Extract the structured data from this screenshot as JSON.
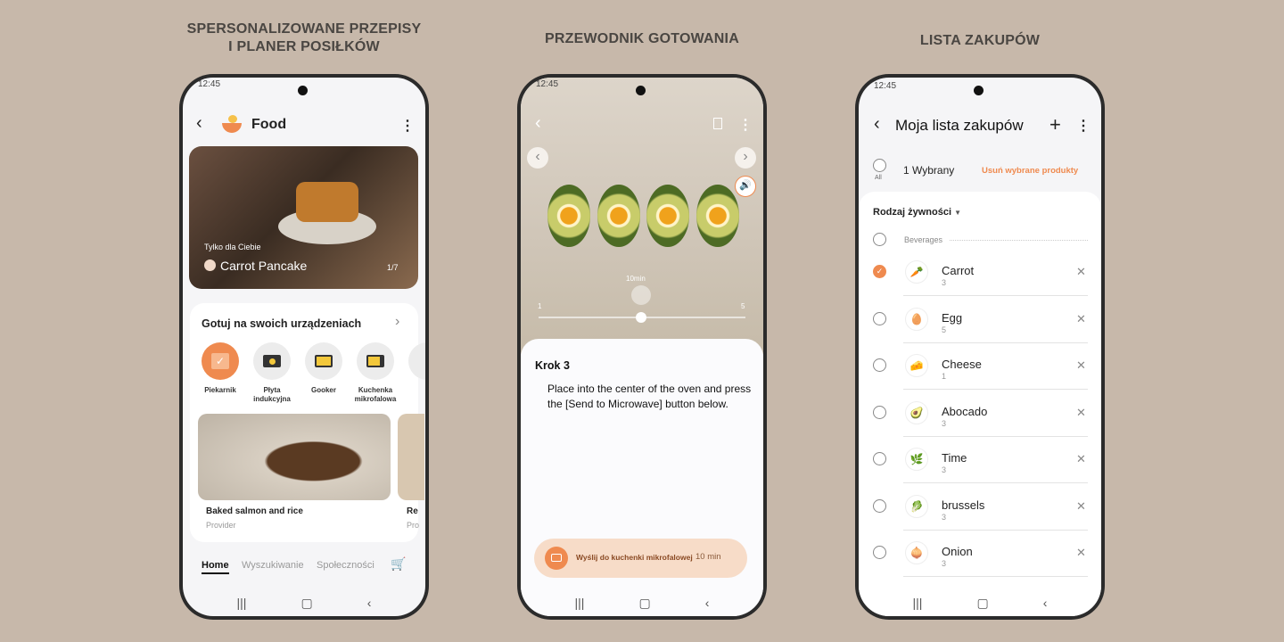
{
  "captions": [
    "SPERSONALIZOWANE PRZEPISY",
    "I PLANER POSIŁKÓW",
    "PRZEWODNIK GOTOWANIA",
    "LISTA ZAKUPÓW"
  ],
  "status_time": "12:45",
  "colors": {
    "accent": "#ef8a4f",
    "background": "#c7b8aa"
  },
  "food": {
    "title": "Food",
    "hero": {
      "tag": "Tylko dla Ciebie",
      "title": "Carrot Pancake",
      "counter": "1/7"
    },
    "devices_section": {
      "title": "Gotuj na swoich urządzeniach",
      "devices": [
        {
          "label": "Piekarnik",
          "selected": true
        },
        {
          "label": "Płyta indukcyjna"
        },
        {
          "label": "Gooker"
        },
        {
          "label": "Kuchenka mikrofalowa"
        }
      ]
    },
    "recipes": [
      {
        "title": "Baked salmon and rice",
        "provider": "Provider"
      },
      {
        "title": "Re",
        "provider": "Pro"
      }
    ],
    "tabs": [
      "Home",
      "Wyszukiwanie",
      "Społeczności"
    ]
  },
  "guide": {
    "timer_label": "10min",
    "step_min": "1",
    "step_max": "5",
    "step_current": 3,
    "step_title": "Krok 3",
    "instruction": "Place into the center of the oven and press the [Send to Microwave] button below.",
    "send_button": "Wyślij do kuchenki mikrofalowej",
    "send_time": "10 min"
  },
  "shopping": {
    "title": "Moja lista zakupów",
    "all_label": "All",
    "selected_count": "1 Wybrany",
    "remove_label": "Usuń wybrane produkty",
    "filter": "Rodzaj żywności",
    "category": "Beverages",
    "items": [
      {
        "name": "Carrot",
        "qty": "3",
        "checked": true,
        "icon": "🥕"
      },
      {
        "name": "Egg",
        "qty": "5",
        "icon": "🥚"
      },
      {
        "name": "Cheese",
        "qty": "1",
        "icon": "🧀"
      },
      {
        "name": "Abocado",
        "qty": "3",
        "icon": "🥑"
      },
      {
        "name": "Time",
        "qty": "3",
        "icon": "🌿"
      },
      {
        "name": "brussels",
        "qty": "3",
        "icon": "🥬"
      },
      {
        "name": "Onion",
        "qty": "3",
        "icon": "🧅"
      }
    ]
  }
}
